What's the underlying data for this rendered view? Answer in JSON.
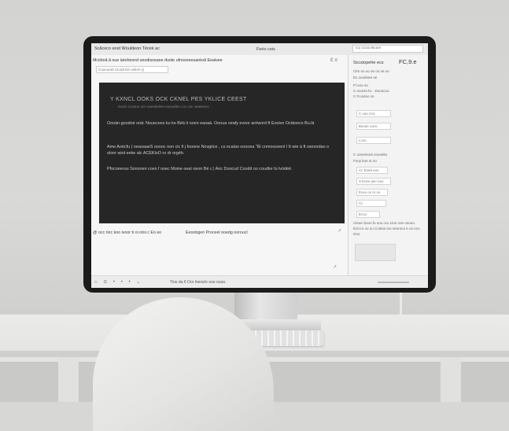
{
  "scene": {
    "description_colors": {
      "wall": "#d5d5d3",
      "bezel": "#1b1b1b",
      "screen_bg": "#f1f1f1",
      "editor_bg": "#262626"
    }
  },
  "window": {
    "app_title": "Scăceco eost Wouldeon Técek ac",
    "center_title": "Feéo ceis",
    "top_search": "Cọ   Ccoo Bcom"
  },
  "doc": {
    "tab_text": "Mcöšoã ã oue äéohesnd unodisosane đuoto ufnosneeuarèoã Eeaivee",
    "tab_icons": "Ɛ  ≡",
    "subtab": "Cuocuorit Ciooă Eé oolivé Q"
  },
  "editor": {
    "heading": "Y   KXNCL OOKS  OCK CKNEL PES  YKLICE  CEEST",
    "subheading": "éooiơ cconuo ocn ooeskoèev ooooeâm coc coc oeasesco",
    "p1": "Oooán.goodoé ooä: Nouecees ku ke Béä it ooen eaoaà. Oooua oeafy eveor arriword ft Eooivo Octàoecs Bu.lá",
    "p2": "Ame Aoécfu ( oeaoaaeS ooooc oon cic  fi j fooone Novgtice , cs ecalao ooooea  \"IE cnmooceenl I ƀ wie à ft owoordao o olonr wiot eeke alc  ACEKloO ro dr orgéh.",
    "p3": "Pfocoeeruu Sonooen coes f ooec Moine oeaì oeon Bé c  |   Aoc Doocud Coodit oo coudke fu lvódéè."
  },
  "doc_footer": {
    "left": "@ occ rioc koo ivoor ti oi otoi c  Eo  eo",
    "right": "Eeoobgen Proceel ooedg ooroucl",
    "arrow": "↗",
    "corner": "↗"
  },
  "status": {
    "icons": "⌂ ⊙ • • • ⌄",
    "text": "Tioo da 6 Oor lnerw/o ooe ouoo."
  },
  "sidebar": {
    "title": "Sccsiopehe ecs",
    "version": "FC,9.e",
    "items": [
      "Céo  oo oo oe oo oe oo",
      "Ec ooodoee oe",
      "Fl  ooo  oo",
      "C ooocto kc . Dooocoo",
      "C  Fcooloo ce",
      "C  ooo Cce",
      "Boooè coeo",
      "Lcoo",
      "C ooeoreoot ooooeko",
      "Fooy koe ot oo",
      "Cc  Eoeà  ooo",
      "S Eoee jeer eoo",
      "Ecee oo  ro oo",
      "Cc",
      "Ecoo"
    ],
    "footer": "Cieue Sooo fu ooo cco Llon ooe oouoo. Ecicco oo ou Coolao ioo oeuroco e oo oco Ooo"
  }
}
